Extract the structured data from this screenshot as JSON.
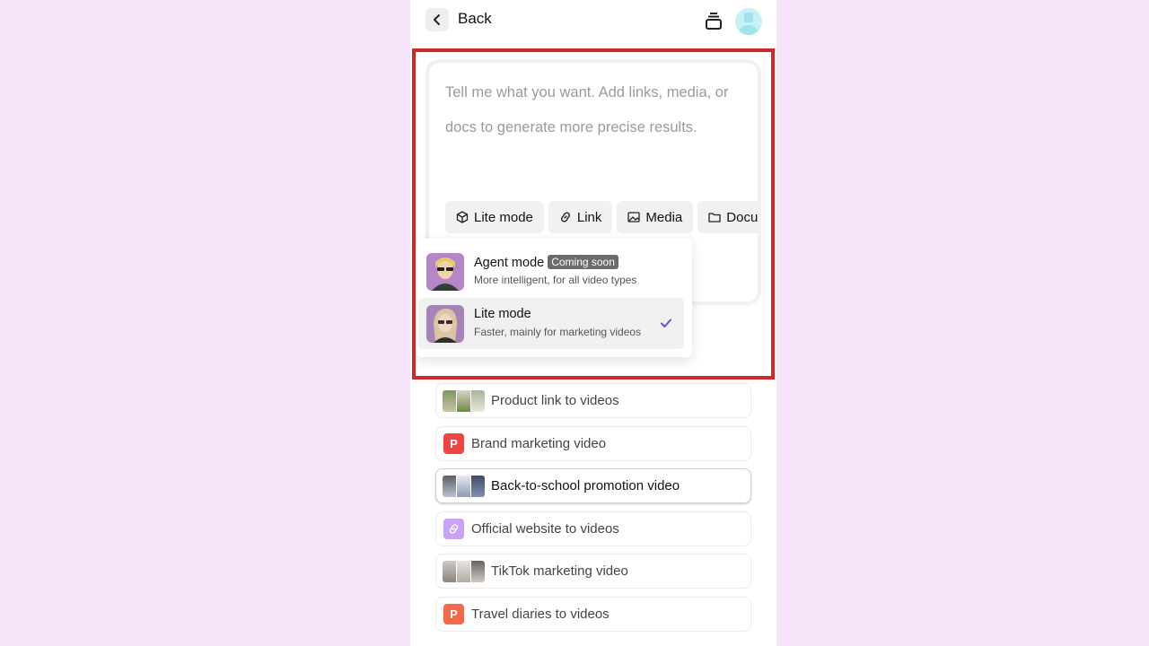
{
  "header": {
    "back_label": "Back",
    "icons": [
      "chevron-left-icon",
      "stack-icon",
      "avatar"
    ]
  },
  "prompt": {
    "placeholder": "Tell me what you want. Add links, media, or docs to generate more precise results."
  },
  "chips": [
    {
      "label": "Lite mode",
      "icon": "cube-icon"
    },
    {
      "label": "Link",
      "icon": "link-icon"
    },
    {
      "label": "Media",
      "icon": "image-icon"
    },
    {
      "label": "Docu",
      "icon": "folder-icon"
    }
  ],
  "mode_menu": {
    "options": [
      {
        "title": "Agent mode",
        "badge": "Coming soon",
        "subtitle": "More intelligent, for all video types"
      },
      {
        "title": "Lite mode",
        "subtitle": "Faster, mainly for marketing videos",
        "selected": true
      }
    ]
  },
  "templates": [
    {
      "label": "Product link to videos",
      "thumb": "photos"
    },
    {
      "label": "Brand marketing video",
      "thumb": "p-badge",
      "color": "#ee4444"
    },
    {
      "label": "Back-to-school promotion video",
      "thumb": "photos",
      "active": true
    },
    {
      "label": "Official website to videos",
      "thumb": "link-badge",
      "color": "#c9a2f2"
    },
    {
      "label": "TikTok marketing video",
      "thumb": "photos"
    },
    {
      "label": "Travel diaries to videos",
      "thumb": "p-badge",
      "color": "#f26a4b"
    }
  ],
  "colors": {
    "background": "#f6e3fa",
    "highlight": "#cc2a2a",
    "check": "#5b56c9"
  }
}
